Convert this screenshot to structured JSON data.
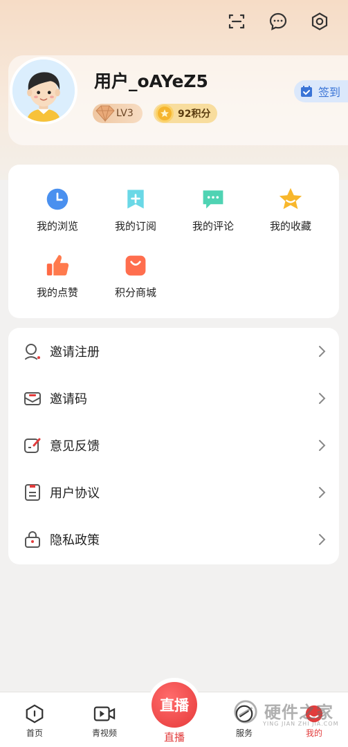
{
  "header": {
    "icons": [
      "scan-icon",
      "message-icon",
      "settings-icon"
    ]
  },
  "profile": {
    "username": "用户_oAYeZ5",
    "level": "LV3",
    "points": "92积分",
    "signin_label": "签到"
  },
  "grid": {
    "items": [
      {
        "label": "我的浏览",
        "icon": "history-icon"
      },
      {
        "label": "我的订阅",
        "icon": "subscribe-icon"
      },
      {
        "label": "我的评论",
        "icon": "comment-icon"
      },
      {
        "label": "我的收藏",
        "icon": "star-icon"
      },
      {
        "label": "我的点赞",
        "icon": "thumbs-up-icon"
      },
      {
        "label": "积分商城",
        "icon": "shopping-bag-icon"
      }
    ]
  },
  "menu": {
    "items": [
      {
        "label": "邀请注册",
        "icon": "invite-user-icon"
      },
      {
        "label": "邀请码",
        "icon": "envelope-icon"
      },
      {
        "label": "意见反馈",
        "icon": "feedback-icon"
      },
      {
        "label": "用户协议",
        "icon": "document-icon"
      },
      {
        "label": "隐私政策",
        "icon": "lock-icon"
      }
    ]
  },
  "tabbar": {
    "items": [
      {
        "label": "首页",
        "icon": "home-icon"
      },
      {
        "label": "青视频",
        "icon": "video-icon"
      },
      {
        "label": "直播",
        "icon": "live-icon",
        "badge_text": "直播"
      },
      {
        "label": "服务",
        "icon": "service-icon"
      },
      {
        "label": "我的",
        "icon": "profile-icon"
      }
    ],
    "active": "我的"
  },
  "watermark": {
    "text": "硬件之家",
    "subtext": "YING JIAN ZHI JIA.COM"
  },
  "colors": {
    "accent_red": "#e23c3c",
    "signin_blue": "#3a74d6",
    "background": "#f2f1f0"
  }
}
